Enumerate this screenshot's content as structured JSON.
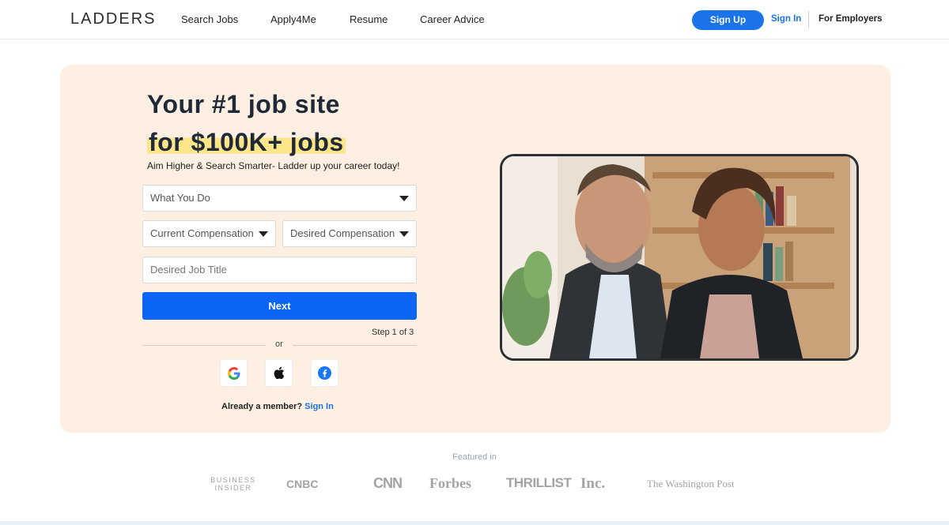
{
  "header": {
    "logo": "LADDERS",
    "nav": [
      "Search Jobs",
      "Apply4Me",
      "Resume",
      "Career Advice"
    ],
    "signup": "Sign Up",
    "signin": "Sign In",
    "employers": "For Employers"
  },
  "hero": {
    "title_line1": "Your #1 job site",
    "title_line2": "for $100K+ jobs",
    "subtitle": "Aim Higher & Search Smarter- Ladder up your career today!",
    "field_what_you_do": "What You Do",
    "field_current_comp": "Current Compensation",
    "field_desired_comp": "Desired Compensation",
    "field_job_title_placeholder": "Desired Job Title",
    "next_button": "Next",
    "step": "Step 1 of 3",
    "or": "or",
    "member_text": "Already a member?",
    "member_link": "Sign In"
  },
  "featured": {
    "label": "Featured in",
    "logos": [
      "BUSINESS INSIDER",
      "CNBC",
      "CNN",
      "Forbes",
      "THRILLIST",
      "Inc.",
      "The Washington Post"
    ]
  },
  "colors": {
    "accent": "#1a73e8",
    "next_button": "#0b66f5",
    "hero_bg": "#fdf0e2",
    "highlight": "#fde68a"
  },
  "icons": [
    "google-icon",
    "apple-icon",
    "facebook-icon",
    "caret-down-icon"
  ]
}
